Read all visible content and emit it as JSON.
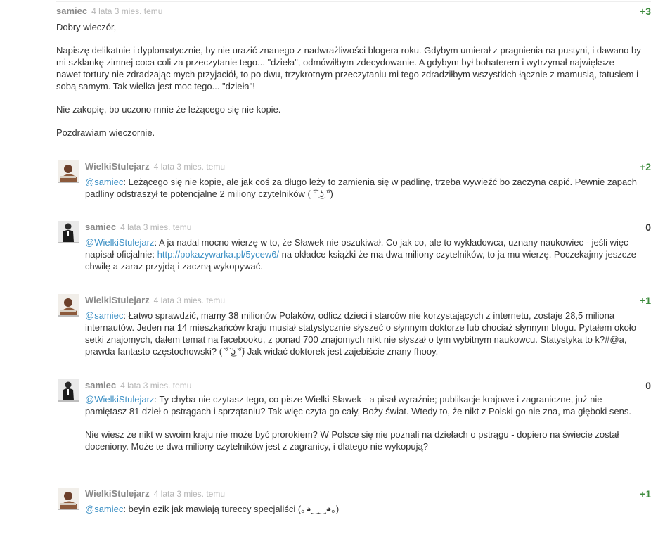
{
  "comments": [
    {
      "author": "samiec",
      "time": "4 lata 3 mies. temu",
      "score": "+3",
      "paragraphs": [
        "Dobry wieczór,",
        "Napiszę delikatnie i dyplomatycznie, by nie urazić znanego z nadwrażliwości blogera roku. Gdybym umierał z pragnienia na pustyni, i dawano by mi szklankę zimnej coca coli za przeczytanie tego... \"dzieła\", odmówiłbym zdecydowanie. A gdybym był bohaterem i wytrzymał największe nawet tortury nie zdradzając mych przyjaciół, to po dwu, trzykrotnym przeczytaniu mi tego zdradziłbym wszystkich łącznie z mamusią, tatusiem i sobą samym. Tak wielka jest moc tego... \"dzieła\"!",
        "Nie zakopię, bo uczono mnie że leżącego się nie kopie.",
        "Pozdrawiam wieczornie."
      ]
    },
    {
      "author": "WielkiStulejarz",
      "time": "4 lata 3 mies. temu",
      "score": "+2",
      "mention": "@samiec",
      "text": ": Leżącego się nie kopie, ale jak coś za długo leży to zamienia się w padlinę, trzeba wywieźć bo zaczyna capić. Pewnie zapach padliny odstraszył te potencjalne 2 miliony czytelników ( ͡° ͜ʖ ͡°)"
    },
    {
      "author": "samiec",
      "time": "4 lata 3 mies. temu",
      "score": "0",
      "mention": "@WielkiStulejarz",
      "text_before": ": A ja nadal mocno wierzę w to, że Sławek nie oszukiwał. Co jak co, ale to wykładowca, uznany naukowiec - jeśli więc napisał oficjalnie: ",
      "link": "http://pokazywarka.pl/5ycew6/",
      "text_after": " na okładce książki że ma dwa miliony czytelników, to ja mu wierzę. Poczekajmy jeszcze chwilę a zaraz przyjdą i zaczną wykopywać."
    },
    {
      "author": "WielkiStulejarz",
      "time": "4 lata 3 mies. temu",
      "score": "+1",
      "mention": "@samiec",
      "text": ": Łatwo sprawdzić, mamy 38 milionów Polaków, odlicz dzieci i starców nie korzystających z internetu, zostaje 28,5 miliona internautów. Jeden na 14 mieszkańców kraju musiał statystycznie słyszeć o słynnym doktorze lub chociaż słynnym blogu. Pytałem około setki znajomych, dałem temat na facebooku, z ponad 700 znajomych nikt nie słyszał o tym wybitnym naukowcu. Statystyka to k?#@a, prawda fantasto częstochowski? ( ͡° ͜ʖ ͡°) Jak widać doktorek jest zajebiście znany fhooy."
    },
    {
      "author": "samiec",
      "time": "4 lata 3 mies. temu",
      "score": "0",
      "mention": "@WielkiStulejarz",
      "text": ": Ty chyba nie czytasz tego, co pisze Wielki Sławek - a pisał wyraźnie; publikacje krajowe i zagraniczne, już nie pamiętasz 81 dzieł o pstrągach i sprzątaniu? Tak więc czyta go cały, Boży świat. Wtedy to, że nikt z Polski go nie zna, ma głęboki sens.",
      "text2": "Nie wiesz że nikt w swoim kraju nie może być prorokiem? W Polsce się nie poznali na dziełach o pstrągu - dopiero na świecie został doceniony. Może te dwa miliony czytelników jest z zagranicy, i dlatego nie wykopują?"
    },
    {
      "author": "WielkiStulejarz",
      "time": "4 lata 3 mies. temu",
      "score": "+1",
      "mention": "@samiec",
      "text": ": beyin ezik jak mawiają tureccy specjaliści (｡◕‿‿◕｡)"
    }
  ],
  "colors": {
    "author": "#8a8a8a",
    "time": "#b6b6b6",
    "positive_score": "#3d8b3d",
    "link": "#3b8fc4"
  },
  "icons": {
    "avatar_stulejarz": "avatar-person-reclining",
    "avatar_samiec": "avatar-person-dark-suit"
  }
}
